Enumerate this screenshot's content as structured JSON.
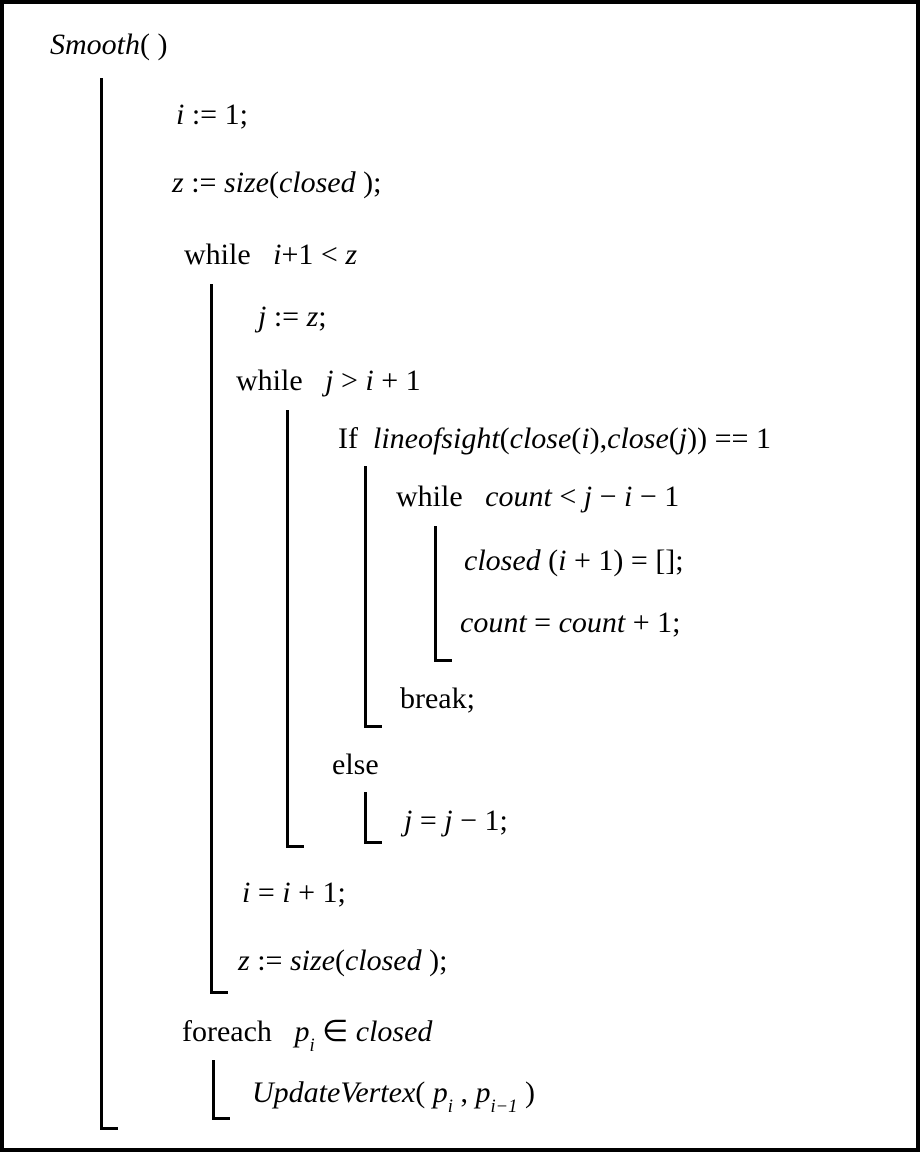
{
  "algo": {
    "title_html": "<span class='italic'>Smooth</span>( )",
    "line_i1": "<span class='italic'>i</span> := 1;",
    "line_z_size": "<span class='italic'>z</span> := <span class='italic'>size</span>(<span class='italic'>closed</span> );",
    "while_outer": "<span class='upright'>while</span>&nbsp;&nbsp;&nbsp;<span class='italic'>i</span>+1 &lt; <span class='italic'>z</span>",
    "j_assign": "<span class='italic'>j</span> := <span class='italic'>z</span>;",
    "while_inner": "<span class='upright'>while</span>&nbsp;&nbsp;&nbsp;<span class='italic'>j</span> &gt; <span class='italic'>i</span> + 1",
    "if_line": "<span class='upright'>If</span>&nbsp;&nbsp;<span class='italic'>lineofsight</span>(<span class='italic'>close</span>(<span class='italic'>i</span>),<span class='italic'>close</span>(<span class='italic'>j</span>)) == 1",
    "while_count": "<span class='upright'>while</span>&nbsp;&nbsp;&nbsp;<span class='italic'>count</span> &lt; <span class='italic'>j</span> &minus; <span class='italic'>i</span> &minus; 1",
    "closed_empty": "<span class='italic'>closed</span> (<span class='italic'>i</span> + 1) = [];",
    "count_inc": "<span class='italic'>count</span> = <span class='italic'>count</span> + 1;",
    "break_line": "<span class='upright'>break;</span>",
    "else_line": "<span class='upright'>else</span>",
    "j_dec": "<span class='italic'>j</span> = <span class='italic'>j</span> &minus; 1;",
    "i_inc": "<span class='italic'>i</span> = <span class='italic'>i</span> + 1;",
    "z_size2": "<span class='italic'>z</span> := <span class='italic'>size</span>(<span class='italic'>closed</span> );",
    "foreach_line": "<span class='upright'>foreach</span>&nbsp;&nbsp;&nbsp;<span class='italic'>p<span class='sub'>i</span></span> &isin; <span class='italic'>closed</span>",
    "update_vertex": "<span class='italic'>UpdateVertex</span>( <span class='italic'>p<span class='sub'>i</span></span> , <span class='italic'>p<span class='sub'>i&minus;1</span></span> )"
  }
}
